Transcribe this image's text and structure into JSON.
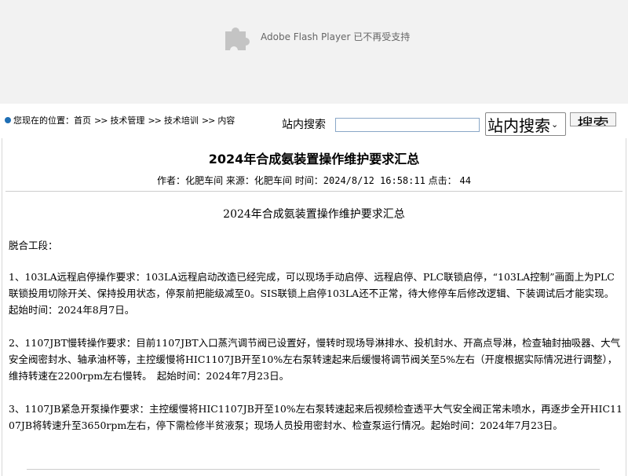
{
  "flash": {
    "icon": "puzzle-plugin-icon",
    "message": "Adobe Flash Player 已不再受支持"
  },
  "breadcrumb": {
    "prefix": "您现在的位置：",
    "items": [
      "首页",
      "技术管理",
      "技术培训",
      "内容"
    ],
    "separator": ">>"
  },
  "search": {
    "label": "站内搜索",
    "input_value": "",
    "select_value": "站内搜索",
    "button_label": "搜索"
  },
  "article": {
    "title": "2024年合成氨装置操作维护要求汇总",
    "meta": {
      "author_label": "作者：",
      "author": "化肥车间",
      "source_label": "来源：",
      "source": "化肥车间",
      "time_label": "时间：",
      "time": "2024/8/12 16:58:11",
      "clicks_label": "点击：",
      "clicks": "44"
    },
    "subtitle": "2024年合成氨装置操作维护要求汇总",
    "section": "脱合工段：",
    "paragraphs": [
      "1、103LA远程启停操作要求：103LA远程启动改造已经完成，可以现场手动启停、远程启停、PLC联锁启停，“103LA控制”画面上为PLC联锁投用切除开关、保持投用状态，停泵前把能级减至0。SIS联锁上启停103LA还不正常，待大修停车后修改逻辑、下装调试后才能实现。起始时间：2024年8月7日。",
      "2、1107JBT慢转操作要求：目前1107JBT入口蒸汽调节阀已设置好，慢转时现场导淋排水、投机封水、开高点导淋，检查轴封抽吸器、大气安全阀密封水、轴承油杯等，主控缓慢将HIC1107JB开至10%左右泵转速起来后缓慢将调节阀关至5%左右（开度根据实际情况进行调整），维持转速在2200rpm左右慢转。　起始时间：2024年7月23日。",
      "3、1107JB紧急开泵操作要求：主控缓慢将HIC1107JB开至10%左右泵转速起来后视频检查透平大气安全阀正常未喷水，再逐步全开HIC1107JB将转速升至3650rpm左右，停下需检修半贫液泵；现场人员投用密封水、检查泵运行情况。起始时间：2024年7月23日。"
    ]
  }
}
